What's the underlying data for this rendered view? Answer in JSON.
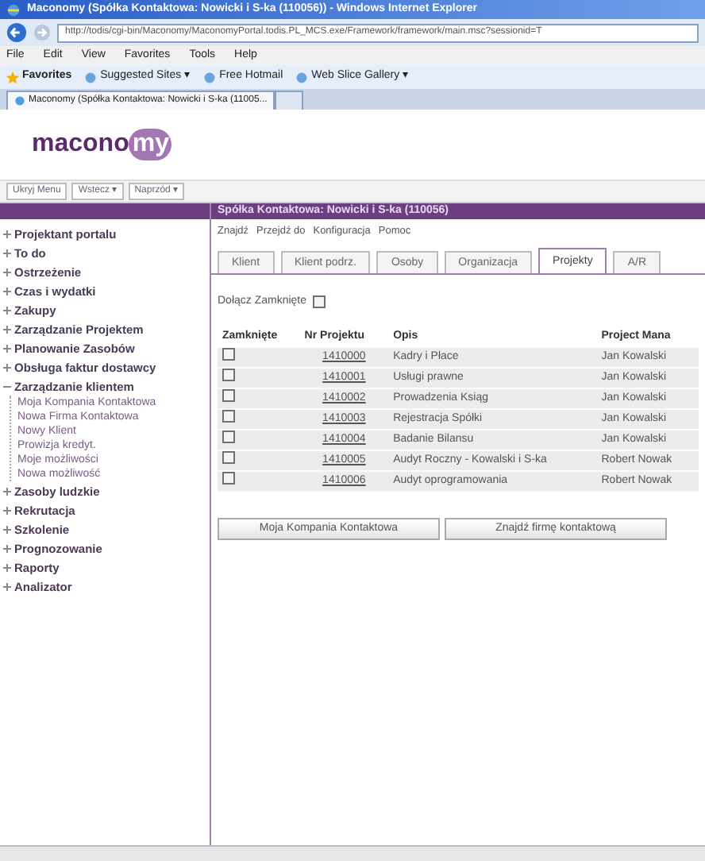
{
  "window": {
    "title": "Maconomy (Spółka Kontaktowa: Nowicki i S-ka (110056)) - Windows Internet Explorer"
  },
  "address_bar": {
    "url": "http://todis/cgi-bin/Maconomy/MaconomyPortal.todis.PL_MCS.exe/Framework/framework/main.msc?sessionid=T"
  },
  "menu_bar": [
    "File",
    "Edit",
    "View",
    "Favorites",
    "Tools",
    "Help"
  ],
  "favorites_bar": [
    {
      "label": "Favorites",
      "kind": "star"
    },
    {
      "label": "Suggested Sites ▾",
      "kind": "link"
    },
    {
      "label": "Free Hotmail",
      "kind": "link"
    },
    {
      "label": "Web Slice Gallery ▾",
      "kind": "link"
    }
  ],
  "browser_tab": {
    "title": "Maconomy (Spółka Kontaktowa: Nowicki i S-ka (11005..."
  },
  "logo": {
    "text_left": "macono",
    "text_badge": "my"
  },
  "toolbar": [
    "Ukryj Menu",
    "Wstecz ▾",
    "Naprzód ▾"
  ],
  "sidebar": {
    "items": [
      {
        "label": "Projektant portalu",
        "expanded": false
      },
      {
        "label": "To do",
        "expanded": false
      },
      {
        "label": "Ostrzeżenie",
        "expanded": false
      },
      {
        "label": "Czas i wydatki",
        "expanded": false
      },
      {
        "label": "Zakupy",
        "expanded": false
      },
      {
        "label": "Zarządzanie Projektem",
        "expanded": false
      },
      {
        "label": "Planowanie Zasobów",
        "expanded": false
      },
      {
        "label": "Obsługa faktur dostawcy",
        "expanded": false
      },
      {
        "label": "Zarządzanie klientem",
        "expanded": true,
        "children": [
          {
            "label": "Moja Kompania Kontaktowa"
          },
          {
            "label": "Nowa Firma Kontaktowa"
          },
          {
            "label": "Nowy Klient"
          },
          {
            "label": "Prowizja kredyt."
          },
          {
            "label": "Moje możliwości"
          },
          {
            "label": "Nowa możliwość"
          }
        ]
      },
      {
        "label": "Zasoby ludzkie",
        "expanded": false
      },
      {
        "label": "Rekrutacja",
        "expanded": false
      },
      {
        "label": "Szkolenie",
        "expanded": false
      },
      {
        "label": "Prognozowanie",
        "expanded": false
      },
      {
        "label": "Raporty",
        "expanded": false
      },
      {
        "label": "Analizator",
        "expanded": false
      }
    ]
  },
  "panel": {
    "title": "Spółka Kontaktowa: Nowicki i S-ka (110056)",
    "menu": [
      "Znajdź",
      "Przejdź do",
      "Konfiguracja",
      "Pomoc"
    ],
    "tabs": [
      {
        "label": "Klient",
        "selected": false
      },
      {
        "label": "Klient podrz.",
        "selected": false
      },
      {
        "label": "Osoby",
        "selected": false
      },
      {
        "label": "Organizacja",
        "selected": false
      },
      {
        "label": "Projekty",
        "selected": true
      },
      {
        "label": "A/R",
        "selected": false
      }
    ],
    "include_closed": {
      "label": "Dołącz Zamknięte",
      "checked": false
    },
    "table": {
      "columns": [
        "Zamknięte",
        "Nr Projektu",
        "Opis",
        "Project Mana"
      ],
      "rows": [
        {
          "closed": false,
          "number": "1410000",
          "description": "Kadry i Płace",
          "manager": "Jan Kowalski"
        },
        {
          "closed": false,
          "number": "1410001",
          "description": "Usługi prawne",
          "manager": "Jan Kowalski"
        },
        {
          "closed": false,
          "number": "1410002",
          "description": "Prowadzenia Ksiąg",
          "manager": "Jan Kowalski"
        },
        {
          "closed": false,
          "number": "1410003",
          "description": "Rejestracja Spółki",
          "manager": "Jan Kowalski"
        },
        {
          "closed": false,
          "number": "1410004",
          "description": "Badanie Bilansu",
          "manager": "Jan Kowalski"
        },
        {
          "closed": false,
          "number": "1410005",
          "description": "Audyt Roczny - Kowalski i S-ka",
          "manager": "Robert Nowak"
        },
        {
          "closed": false,
          "number": "1410006",
          "description": "Audyt oprogramowania",
          "manager": "Robert Nowak"
        }
      ]
    },
    "buttons": [
      "Moja Kompania Kontaktowa",
      "Znajdź firmę kontaktową"
    ]
  }
}
